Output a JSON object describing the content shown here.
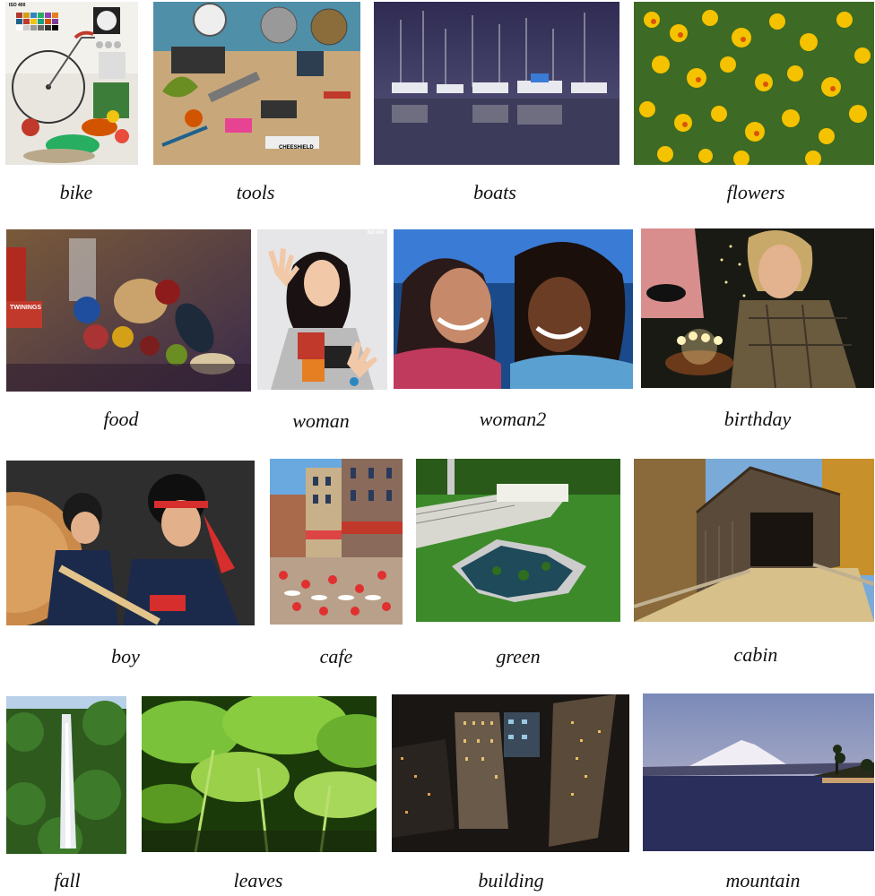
{
  "gallery": {
    "rows": [
      [
        {
          "id": "bike",
          "caption": "bike",
          "badge": "ISO 400"
        },
        {
          "id": "tools",
          "caption": "tools",
          "label": "CHEESHIELD"
        },
        {
          "id": "boats",
          "caption": "boats"
        },
        {
          "id": "flowers",
          "caption": "flowers"
        }
      ],
      [
        {
          "id": "food",
          "caption": "food",
          "label": "TWININGS"
        },
        {
          "id": "woman",
          "caption": "woman",
          "badge": "ISO 400"
        },
        {
          "id": "woman2",
          "caption": "woman2"
        },
        {
          "id": "birthday",
          "caption": "birthday"
        }
      ],
      [
        {
          "id": "boy",
          "caption": "boy"
        },
        {
          "id": "cafe",
          "caption": "cafe"
        },
        {
          "id": "green",
          "caption": "green"
        },
        {
          "id": "cabin",
          "caption": "cabin"
        }
      ],
      [
        {
          "id": "fall",
          "caption": "fall"
        },
        {
          "id": "leaves",
          "caption": "leaves"
        },
        {
          "id": "building",
          "caption": "building"
        },
        {
          "id": "mountain",
          "caption": "mountain"
        }
      ]
    ]
  }
}
